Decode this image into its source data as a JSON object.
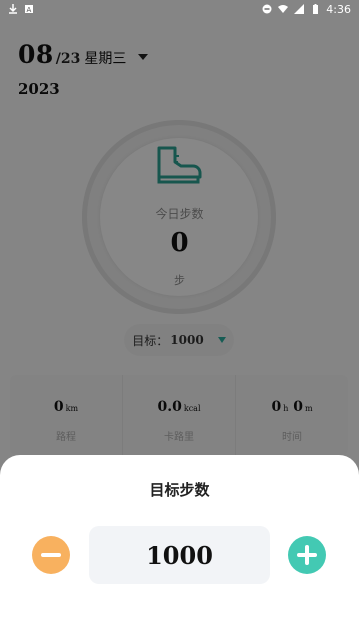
{
  "status_bar": {
    "time": "4:36"
  },
  "header": {
    "date_main": "08",
    "date_sub": "/23",
    "weekday": "星期三",
    "year": "2023"
  },
  "progress": {
    "label": "今日步数",
    "value": "0",
    "unit": "步"
  },
  "goal": {
    "label": "目标：",
    "value": "1000"
  },
  "stats": [
    {
      "value": "0",
      "unit": "km",
      "label": "路程"
    },
    {
      "value": "0.0",
      "unit": "kcal",
      "label": "卡路里"
    },
    {
      "value": "0",
      "unit_h": "h",
      "value_m": "0",
      "unit": "m",
      "label": "时间"
    }
  ],
  "sheet": {
    "title": "目标步数",
    "value": "1000"
  },
  "colors": {
    "accent_teal": "#43c9b3",
    "accent_orange": "#f8b15f"
  },
  "icons": [
    "download-icon",
    "notification-icon",
    "dnd-icon",
    "wifi-icon",
    "signal-icon",
    "battery-icon",
    "shoe-icon",
    "dropdown-icon",
    "minus-icon",
    "plus-icon"
  ]
}
